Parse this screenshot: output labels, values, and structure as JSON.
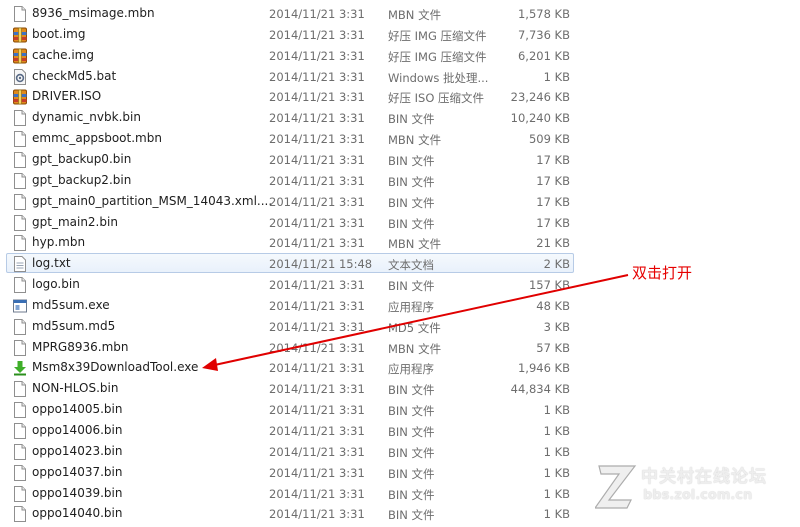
{
  "files": [
    {
      "name": "8936_msimage.mbn",
      "date": "2014/11/21 3:31",
      "type": "MBN 文件",
      "size": "1,578 KB",
      "icon": "generic-file-icon"
    },
    {
      "name": "boot.img",
      "date": "2014/11/21 3:31",
      "type": "好压 IMG 压缩文件",
      "size": "7,736 KB",
      "icon": "archive-icon"
    },
    {
      "name": "cache.img",
      "date": "2014/11/21 3:31",
      "type": "好压 IMG 压缩文件",
      "size": "6,201 KB",
      "icon": "archive-icon"
    },
    {
      "name": "checkMd5.bat",
      "date": "2014/11/21 3:31",
      "type": "Windows 批处理...",
      "size": "1 KB",
      "icon": "batch-file-icon"
    },
    {
      "name": "DRIVER.ISO",
      "date": "2014/11/21 3:31",
      "type": "好压 ISO 压缩文件",
      "size": "23,246 KB",
      "icon": "archive-icon"
    },
    {
      "name": "dynamic_nvbk.bin",
      "date": "2014/11/21 3:31",
      "type": "BIN 文件",
      "size": "10,240 KB",
      "icon": "generic-file-icon"
    },
    {
      "name": "emmc_appsboot.mbn",
      "date": "2014/11/21 3:31",
      "type": "MBN 文件",
      "size": "509 KB",
      "icon": "generic-file-icon"
    },
    {
      "name": "gpt_backup0.bin",
      "date": "2014/11/21 3:31",
      "type": "BIN 文件",
      "size": "17 KB",
      "icon": "generic-file-icon"
    },
    {
      "name": "gpt_backup2.bin",
      "date": "2014/11/21 3:31",
      "type": "BIN 文件",
      "size": "17 KB",
      "icon": "generic-file-icon"
    },
    {
      "name": "gpt_main0_partition_MSM_14043.xml....",
      "date": "2014/11/21 3:31",
      "type": "BIN 文件",
      "size": "17 KB",
      "icon": "generic-file-icon"
    },
    {
      "name": "gpt_main2.bin",
      "date": "2014/11/21 3:31",
      "type": "BIN 文件",
      "size": "17 KB",
      "icon": "generic-file-icon"
    },
    {
      "name": "hyp.mbn",
      "date": "2014/11/21 3:31",
      "type": "MBN 文件",
      "size": "21 KB",
      "icon": "generic-file-icon"
    },
    {
      "name": "log.txt",
      "date": "2014/11/21 15:48",
      "type": "文本文档",
      "size": "2 KB",
      "icon": "text-file-icon",
      "selected": true
    },
    {
      "name": "logo.bin",
      "date": "2014/11/21 3:31",
      "type": "BIN 文件",
      "size": "157 KB",
      "icon": "generic-file-icon"
    },
    {
      "name": "md5sum.exe",
      "date": "2014/11/21 3:31",
      "type": "应用程序",
      "size": "48 KB",
      "icon": "exe-window-icon"
    },
    {
      "name": "md5sum.md5",
      "date": "2014/11/21 3:31",
      "type": "MD5 文件",
      "size": "3 KB",
      "icon": "generic-file-icon"
    },
    {
      "name": "MPRG8936.mbn",
      "date": "2014/11/21 3:31",
      "type": "MBN 文件",
      "size": "57 KB",
      "icon": "generic-file-icon"
    },
    {
      "name": "Msm8x39DownloadTool.exe",
      "date": "2014/11/21 3:31",
      "type": "应用程序",
      "size": "1,946 KB",
      "icon": "download-arrow-icon"
    },
    {
      "name": "NON-HLOS.bin",
      "date": "2014/11/21 3:31",
      "type": "BIN 文件",
      "size": "44,834 KB",
      "icon": "generic-file-icon"
    },
    {
      "name": "oppo14005.bin",
      "date": "2014/11/21 3:31",
      "type": "BIN 文件",
      "size": "1 KB",
      "icon": "generic-file-icon"
    },
    {
      "name": "oppo14006.bin",
      "date": "2014/11/21 3:31",
      "type": "BIN 文件",
      "size": "1 KB",
      "icon": "generic-file-icon"
    },
    {
      "name": "oppo14023.bin",
      "date": "2014/11/21 3:31",
      "type": "BIN 文件",
      "size": "1 KB",
      "icon": "generic-file-icon"
    },
    {
      "name": "oppo14037.bin",
      "date": "2014/11/21 3:31",
      "type": "BIN 文件",
      "size": "1 KB",
      "icon": "generic-file-icon"
    },
    {
      "name": "oppo14039.bin",
      "date": "2014/11/21 3:31",
      "type": "BIN 文件",
      "size": "1 KB",
      "icon": "generic-file-icon"
    },
    {
      "name": "oppo14040.bin",
      "date": "2014/11/21 3:31",
      "type": "BIN 文件",
      "size": "1 KB",
      "icon": "generic-file-icon"
    }
  ],
  "annotation": {
    "text": "双击打开",
    "color": "#e60000"
  },
  "watermark": {
    "line1": "中关村在线论坛",
    "line2": "bbs.zol.com.cn"
  }
}
